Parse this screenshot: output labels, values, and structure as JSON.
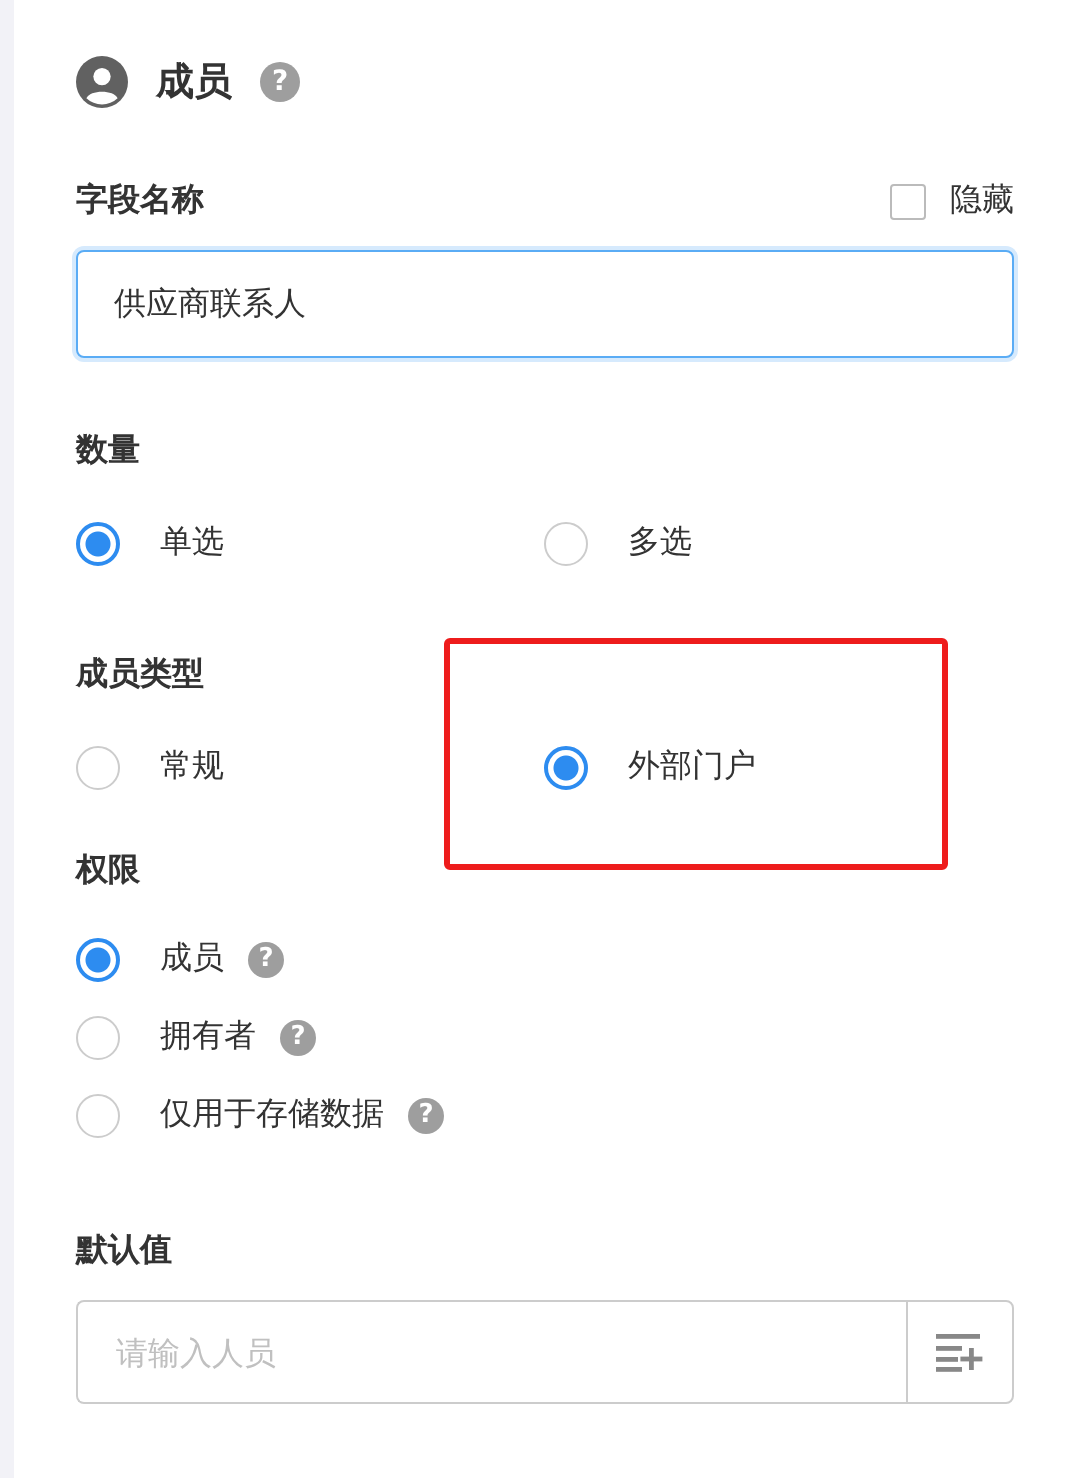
{
  "header": {
    "title": "成员",
    "help": "?"
  },
  "field_name": {
    "label": "字段名称",
    "hidden_toggle": {
      "label": "隐藏",
      "checked": false
    },
    "value": "供应商联系人",
    "focused": true
  },
  "quantity": {
    "label": "数量",
    "options": [
      {
        "label": "单选",
        "selected": true
      },
      {
        "label": "多选",
        "selected": false
      }
    ]
  },
  "member_type": {
    "label": "成员类型",
    "options": [
      {
        "label": "常规",
        "selected": false,
        "highlighted": false
      },
      {
        "label": "外部门户",
        "selected": true,
        "highlighted": true
      }
    ]
  },
  "permissions": {
    "label": "权限",
    "options": [
      {
        "label": "成员",
        "selected": true,
        "help": "?"
      },
      {
        "label": "拥有者",
        "selected": false,
        "help": "?"
      },
      {
        "label": "仅用于存储数据",
        "selected": false,
        "help": "?"
      }
    ]
  },
  "default_value": {
    "label": "默认值",
    "placeholder": "请输入人员"
  }
}
